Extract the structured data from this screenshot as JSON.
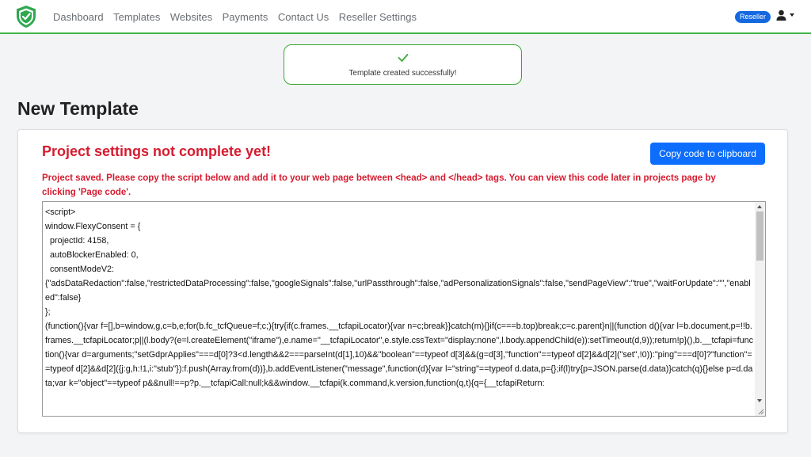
{
  "nav": {
    "links": [
      "Dashboard",
      "Templates",
      "Websites",
      "Payments",
      "Contact Us",
      "Reseller Settings"
    ],
    "badge": "Reseller"
  },
  "toast": {
    "message": "Template created successfully!"
  },
  "page": {
    "title": "New Template"
  },
  "card": {
    "warning_title": "Project settings not complete yet!",
    "copy_button": "Copy code to clipboard",
    "warning_text": "Project saved. Please copy the script below and add it to your web page between <head> and </head> tags. You can view this code later in projects page by clicking 'Page code'.",
    "code": "<script>\nwindow.FlexyConsent = {\n  projectId: 4158,\n  autoBlockerEnabled: 0,\n  consentModeV2:\n{\"adsDataRedaction\":false,\"restrictedDataProcessing\":false,\"googleSignals\":false,\"urlPassthrough\":false,\"adPersonalizationSignals\":false,\"sendPageView\":\"true\",\"waitForUpdate\":\"\",\"enabled\":false}\n};\n(function(){var f=[],b=window,g,c=b,e;for(b.fc_tcfQueue=f;c;){try{if(c.frames.__tcfapiLocator){var n=c;break}}catch(m){}if(c===b.top)break;c=c.parent}n||(function d(){var l=b.document,p=!!b.frames.__tcfapiLocator;p||(l.body?(e=l.createElement(\"iframe\"),e.name=\"__tcfapiLocator\",e.style.cssText=\"display:none\",l.body.appendChild(e)):setTimeout(d,9));return!p}(),b.__tcfapi=function(){var d=arguments;\"setGdprApplies\"===d[0]?3<d.length&&2===parseInt(d[1],10)&&\"boolean\"==typeof d[3]&&(g=d[3],\"function\"==typeof d[2]&&d[2](\"set\",!0)):\"ping\"===d[0]?\"function\"==typeof d[2]&&d[2]({j:g,h:!1,i:\"stub\"}):f.push(Array.from(d))},b.addEventListener(\"message\",function(d){var l=\"string\"==typeof d.data,p={};if(l)try{p=JSON.parse(d.data)}catch(q){}else p=d.data;var k=\"object\"==typeof p&&null!==p?p.__tcfapiCall:null;k&&window.__tcfapi(k.command,k.version,function(q,t){q={__tcfapiReturn:"
  },
  "colors": {
    "brand_green": "#41b54a",
    "danger": "#d61c30",
    "primary": "#0d6efd"
  },
  "icons": {
    "logo": "shield-check-icon",
    "user": "user-icon",
    "toast": "check-icon"
  }
}
